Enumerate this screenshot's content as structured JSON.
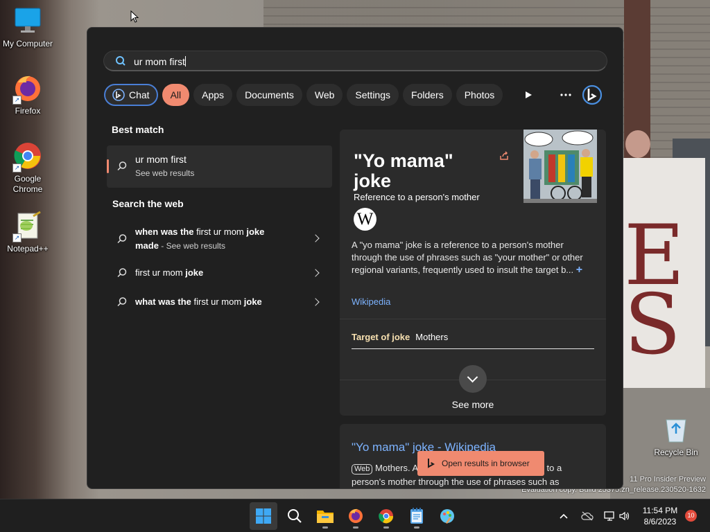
{
  "desktop": {
    "icons": [
      {
        "label": "My Computer"
      },
      {
        "label": "Firefox"
      },
      {
        "label": "Google Chrome"
      },
      {
        "label": "Notepad++"
      },
      {
        "label": "Recycle Bin"
      }
    ],
    "watermark_line1": "11 Pro Insider Preview",
    "watermark_line2": "Evaluation copy. Build 25375.zn_release.230520-1632"
  },
  "search": {
    "query": "ur mom first"
  },
  "filters": {
    "chat": "Chat",
    "all": "All",
    "apps": "Apps",
    "documents": "Documents",
    "web": "Web",
    "settings": "Settings",
    "folders": "Folders",
    "photos": "Photos"
  },
  "results": {
    "best_match_heading": "Best match",
    "best_match": {
      "title": "ur mom first",
      "subtitle": "See web results"
    },
    "search_web_heading": "Search the web",
    "web_items": [
      {
        "pre": "when was the ",
        "mid": "first ur mom ",
        "bold": "joke",
        "line2": "made",
        "suffix": " - See web results"
      },
      {
        "pre": "",
        "mid": "first ur mom ",
        "bold": "joke"
      },
      {
        "pre": "what was the ",
        "mid": "first ur mom ",
        "bold": "joke"
      }
    ]
  },
  "card": {
    "title": "\"Yo mama\" joke",
    "subtitle": "Reference to a person's mother",
    "description": "A \"yo mama\" joke is a reference to a person's mother through the use of phrases such as \"your mother\" or other regional variants, frequently used to insult the target b...",
    "plus": "+",
    "source": "Wikipedia",
    "tab_label": "Target of joke",
    "tab_value": "Mothers",
    "see_more": "See more",
    "wiki_glyph": "W"
  },
  "card2": {
    "title": "\"Yo mama\" joke - Wikipedia",
    "tag": "Web",
    "line1": "Mothers. A",
    "line1_tail": "e to a",
    "line2": "person's mother through the use of phrases such as"
  },
  "toast": {
    "label": "Open results in browser"
  },
  "taskbar": {
    "time": "11:54 PM",
    "date": "8/6/2023",
    "notifications": "10"
  },
  "colors": {
    "accent": "#f08a70",
    "link": "#7db3ff",
    "chat_border": "#4a7fd6",
    "panel_bg": "#202020"
  }
}
